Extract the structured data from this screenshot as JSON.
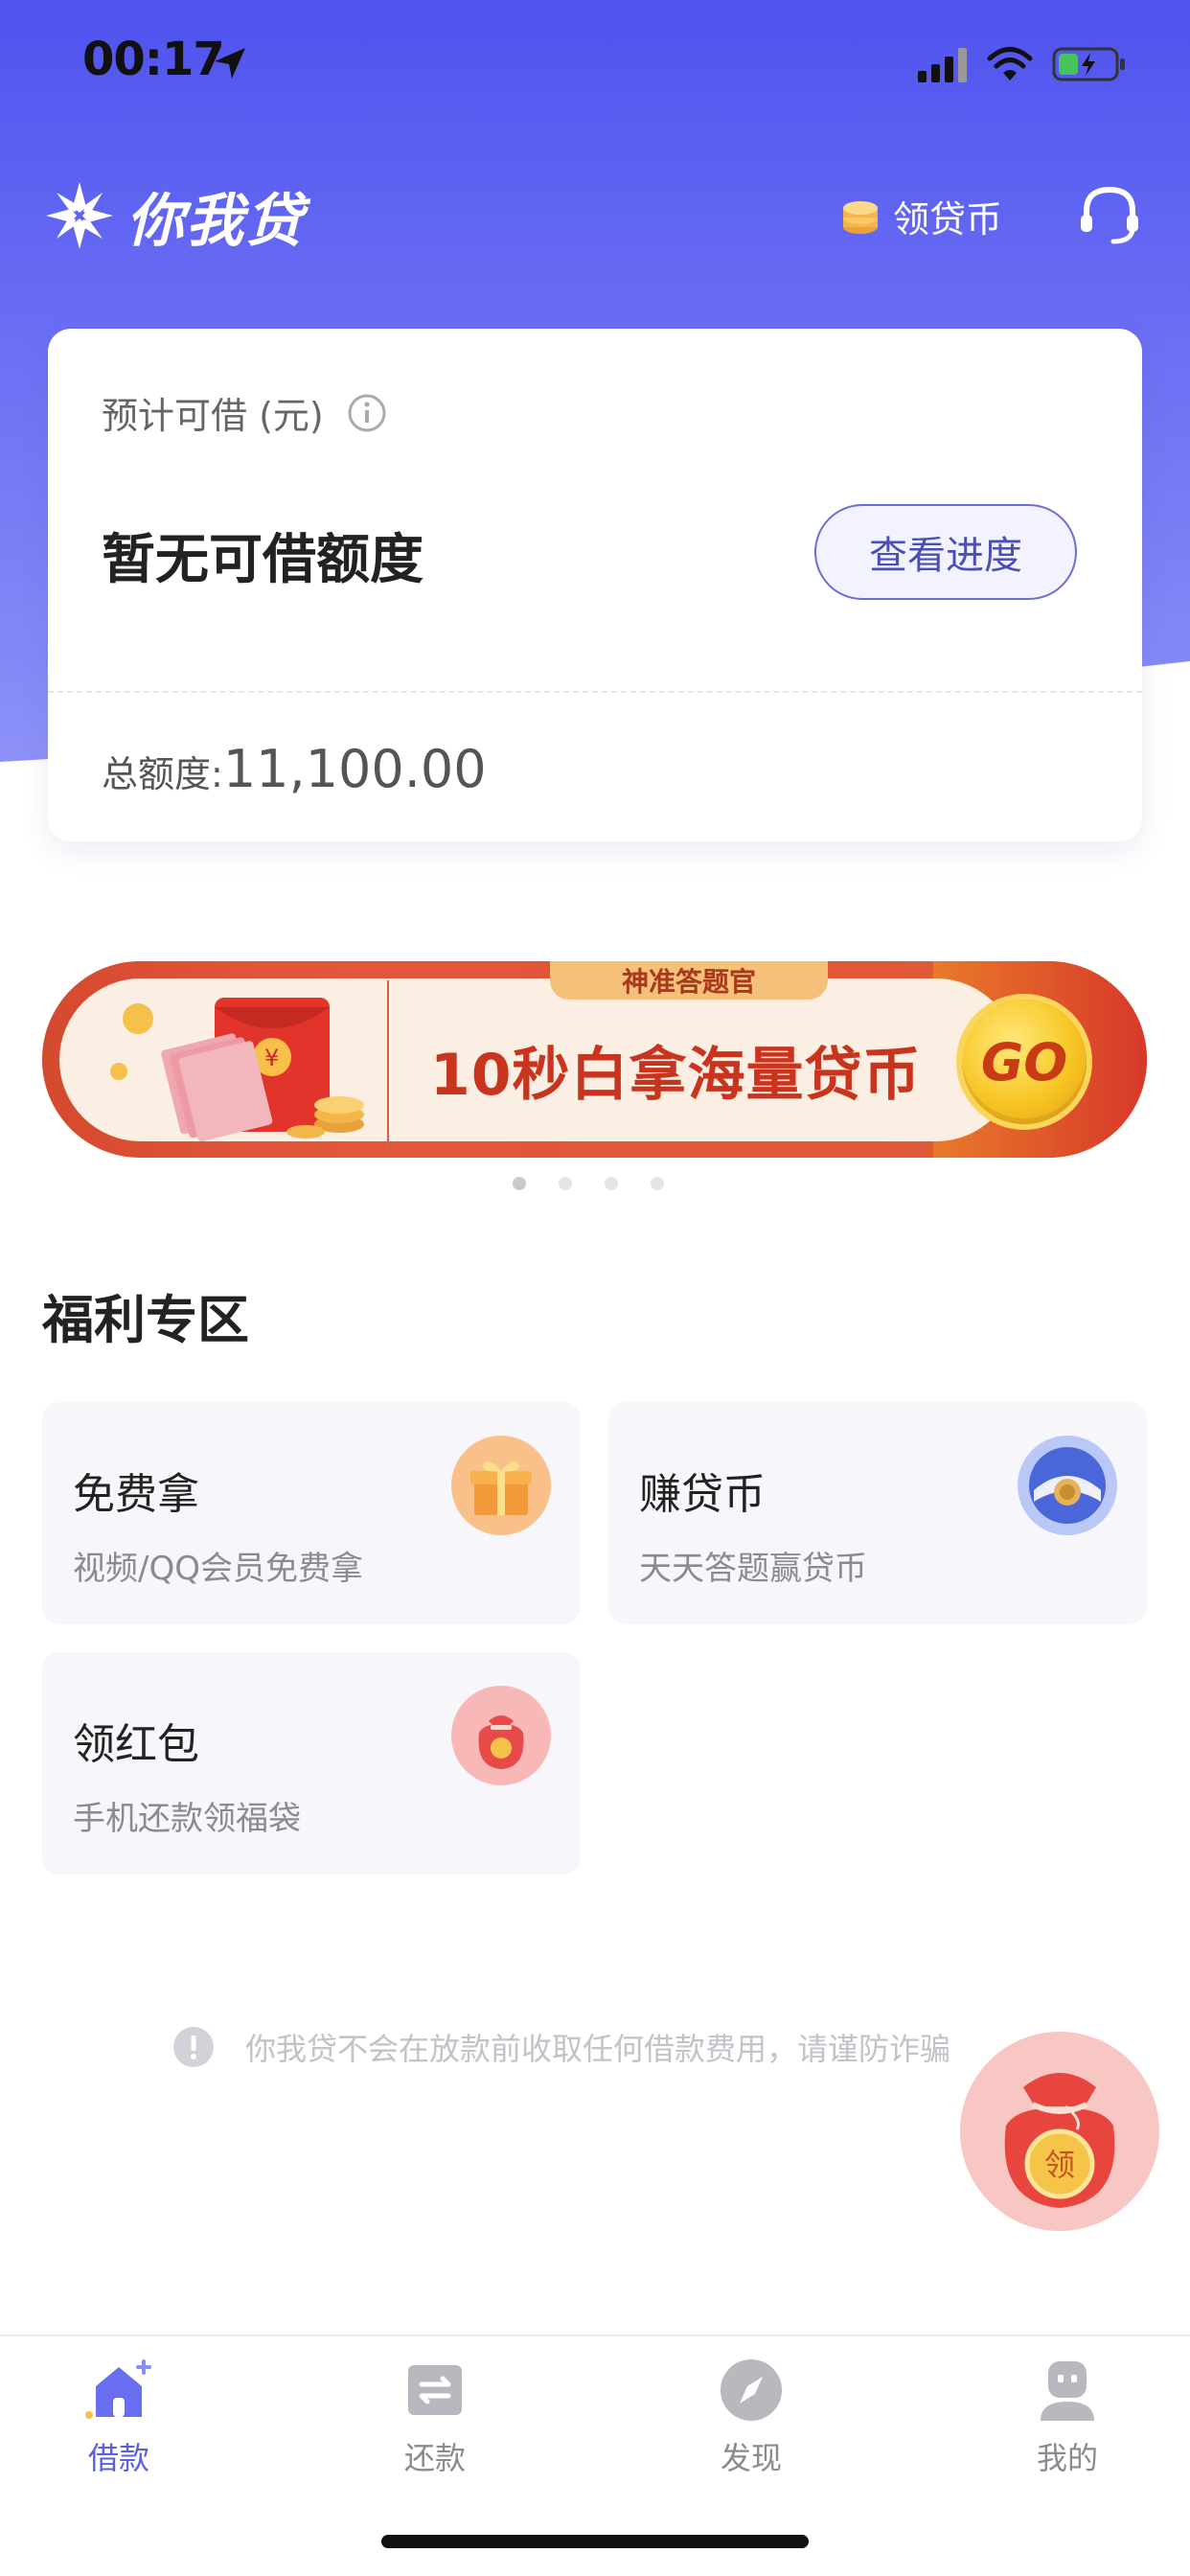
{
  "status_bar": {
    "time": "00:17"
  },
  "header": {
    "app_name": "你我贷",
    "coin_label": "领贷币"
  },
  "loan_card": {
    "estimate_label": "预计可借 (元)",
    "no_limit_text": "暂无可借额度",
    "progress_button": "查看进度",
    "total_label": "总额度:",
    "total_value": "11,100.00"
  },
  "banner": {
    "tag": "神准答题官",
    "title": "10秒白拿海量贷币",
    "go_label": "GO",
    "page_count": 4,
    "active_page": 1
  },
  "welfare": {
    "title": "福利专区",
    "items": [
      {
        "title": "免费拿",
        "subtitle": "视频/QQ会员免费拿",
        "icon": "gift-icon"
      },
      {
        "title": "赚贷币",
        "subtitle": "天天答题赢贷币",
        "icon": "coin-icon"
      },
      {
        "title": "领红包",
        "subtitle": "手机还款领福袋",
        "icon": "red-packet-icon"
      }
    ]
  },
  "notice": {
    "text": "你我贷不会在放款前收取任何借款费用，请谨防诈骗"
  },
  "float_bag": {
    "label": "领"
  },
  "tab_bar": {
    "tabs": [
      {
        "label": "借款",
        "icon": "home-icon",
        "active": true
      },
      {
        "label": "还款",
        "icon": "repay-icon",
        "active": false
      },
      {
        "label": "发现",
        "icon": "compass-icon",
        "active": false
      },
      {
        "label": "我的",
        "icon": "profile-icon",
        "active": false
      }
    ]
  },
  "colors": {
    "primary": "#5b5fe0",
    "hero_top": "#5357f0",
    "hero_bottom": "#8b8ff7"
  }
}
